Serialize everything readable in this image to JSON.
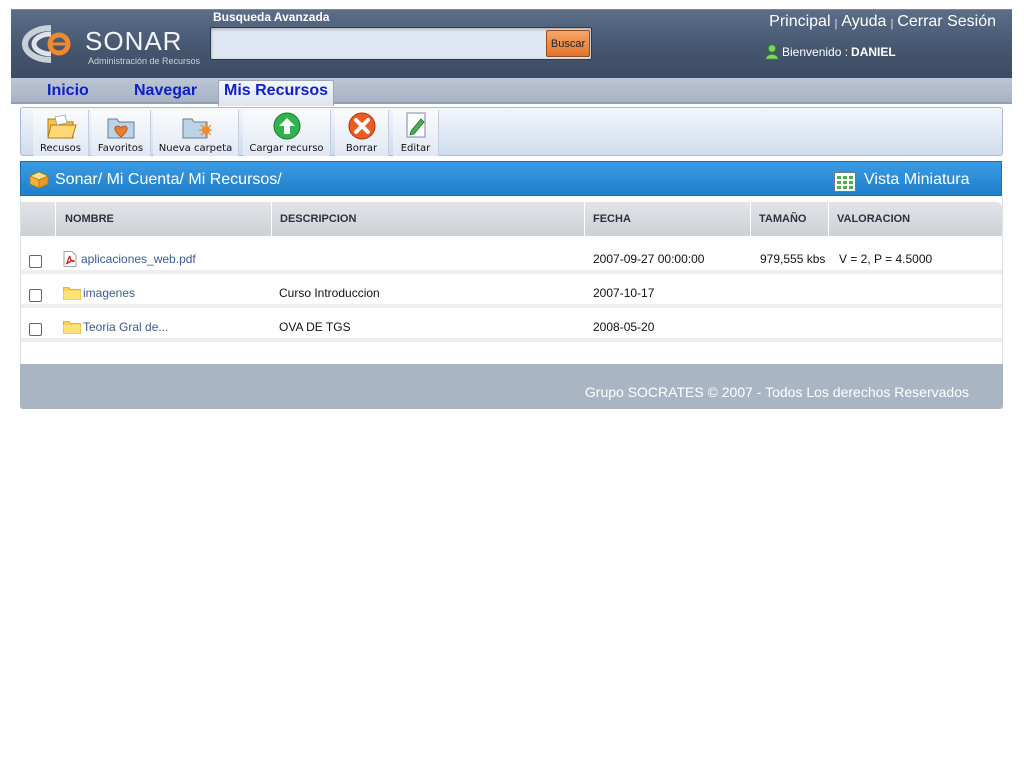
{
  "header": {
    "logo_text": "SONAR",
    "logo_sub": "Administración de Recursos",
    "search_label": "Busqueda Avanzada",
    "search_placeholder": "",
    "search_button": "Buscar",
    "links": [
      "Principal",
      "Ayuda",
      "Cerrar Sesión"
    ],
    "welcome_prefix": "Bienvenido :",
    "user": "DANIEL"
  },
  "tabs": [
    {
      "label": "Inicio",
      "active": false
    },
    {
      "label": "Navegar",
      "active": false
    },
    {
      "label": "Mis Recursos",
      "active": true
    }
  ],
  "toolbar": [
    {
      "label": "Recusos",
      "icon": "folder-open-icon"
    },
    {
      "label": "Favoritos",
      "icon": "favorite-folder-icon"
    },
    {
      "label": "Nueva carpeta",
      "icon": "new-folder-icon"
    },
    {
      "label": "Cargar recurso",
      "icon": "upload-icon"
    },
    {
      "label": "Borrar",
      "icon": "delete-icon"
    },
    {
      "label": "Editar",
      "icon": "edit-icon"
    }
  ],
  "path": {
    "text": "Sonar/ Mi Cuenta/ Mi Recursos/",
    "thumbnail_view": "Vista Miniatura"
  },
  "table": {
    "columns": [
      "NOMBRE",
      "DESCRIPCION",
      "FECHA",
      "TAMAÑO",
      "VALORACION"
    ],
    "rows": [
      {
        "icon": "pdf-icon",
        "name": "aplicaciones_web.pdf",
        "description": "",
        "date": "2007-09-27 00:00:00",
        "size": "979,555 kbs",
        "rating": "V = 2, P = 4.5000"
      },
      {
        "icon": "folder-icon",
        "name": "imagenes",
        "description": "Curso Introduccion",
        "date": "2007-10-17",
        "size": "",
        "rating": ""
      },
      {
        "icon": "folder-icon",
        "name": "Teoria Gral de...",
        "description": "OVA DE TGS",
        "date": "2008-05-20",
        "size": "",
        "rating": ""
      }
    ]
  },
  "footer": {
    "text": "Grupo SOCRATES © 2007 - Todos Los derechos Reservados"
  },
  "colors": {
    "header_bg": "#45556e",
    "tab_text": "#1020c8",
    "path_bar": "#2a8ad4",
    "search_button": "#e0752f",
    "footer_bg": "#aab5c4"
  }
}
